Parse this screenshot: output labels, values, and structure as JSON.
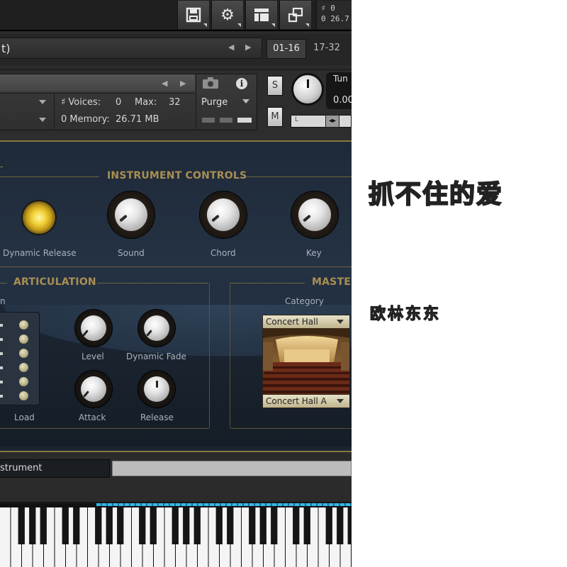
{
  "toolbar": {
    "buttons": [
      {
        "name": "save",
        "icon": "save-icon"
      },
      {
        "name": "options",
        "icon": "gear-icon"
      },
      {
        "name": "view",
        "icon": "layout-icon"
      },
      {
        "name": "minimize",
        "icon": "window-icon"
      }
    ],
    "stats_voices": "♯ 0",
    "stats_memory": "0 26.7"
  },
  "rack": {
    "title": "t)",
    "page_buttons": [
      "01-16",
      "17-32"
    ]
  },
  "instrument_header": {
    "voices_label": "♯ Voices:",
    "voices_value": "0",
    "max_label": "Max:",
    "max_value": "32",
    "memory_label": "0 Memory:",
    "memory_value": "26.71 MB",
    "purge_label": "Purge",
    "solo_label": "S",
    "mute_label": "M",
    "tune_label": "Tun",
    "tune_value": "0.00",
    "pan_left": "L"
  },
  "instrument_controls": {
    "title": "INSTRUMENT CONTROLS",
    "items": [
      {
        "label": "Dynamic Release",
        "type": "led"
      },
      {
        "label": "Sound",
        "type": "knob"
      },
      {
        "label": "Chord",
        "type": "knob"
      },
      {
        "label": "Key",
        "type": "knob"
      }
    ]
  },
  "articulation": {
    "title": "ARTICULATION",
    "partial_label": "n",
    "load_label": "Load",
    "knobs": [
      "Level",
      "Dynamic Fade",
      "Attack",
      "Release"
    ]
  },
  "master": {
    "title": "MASTER",
    "category_label": "Category",
    "category_value": "Concert Hall",
    "preset_value": "Concert Hall A"
  },
  "bottom": {
    "instrument_tab": "strument"
  },
  "overlay": {
    "song_title": "抓不住的爱",
    "artist": "欧林东东"
  },
  "colors": {
    "gold": "#a98f52",
    "panel_bg": "#243244",
    "led_yellow": "#f2d23a",
    "keyboard_range": "#39b6e6"
  }
}
